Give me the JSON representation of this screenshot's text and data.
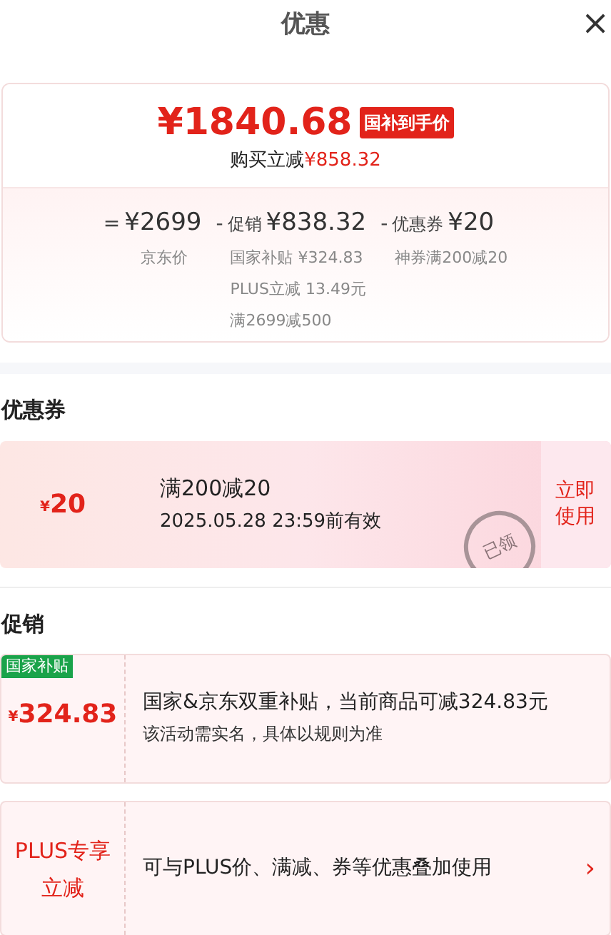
{
  "header": {
    "title": "优惠",
    "close": "×"
  },
  "summary": {
    "price": "¥1840.68",
    "badge": "国补到手价",
    "saving_label": "购买立减",
    "saving_amount": "¥858.32",
    "breakdown": [
      {
        "sign": "=",
        "amount": "¥2699",
        "notes": [
          "京东价"
        ]
      },
      {
        "sign": "-",
        "label": "促销",
        "amount": "¥838.32",
        "notes": [
          "国家补贴 ¥324.83",
          "PLUS立减 13.49元",
          "满2699减500"
        ]
      },
      {
        "sign": "-",
        "label": "优惠券",
        "amount": "¥20",
        "notes": [
          "神券满200减20"
        ]
      }
    ]
  },
  "coupons": {
    "heading": "优惠券",
    "items": [
      {
        "currency": "¥",
        "amount": "20",
        "title": "满200减20",
        "validity": "2025.05.28 23:59前有效",
        "stamp": "已领",
        "claimed": true,
        "action": "立即使用"
      }
    ]
  },
  "promotions": {
    "heading": "促销",
    "items": [
      {
        "kind": "subsidy",
        "tag": "国家补贴",
        "currency": "¥",
        "amount": "324.83",
        "text": "国家&京东双重补贴，当前商品可减324.83元",
        "note": "该活动需实名，具体以规则为准"
      },
      {
        "kind": "plus",
        "label": "PLUS专享立减",
        "text": "可与PLUS价、满减、券等优惠叠加使用",
        "arrow": "›"
      }
    ]
  }
}
